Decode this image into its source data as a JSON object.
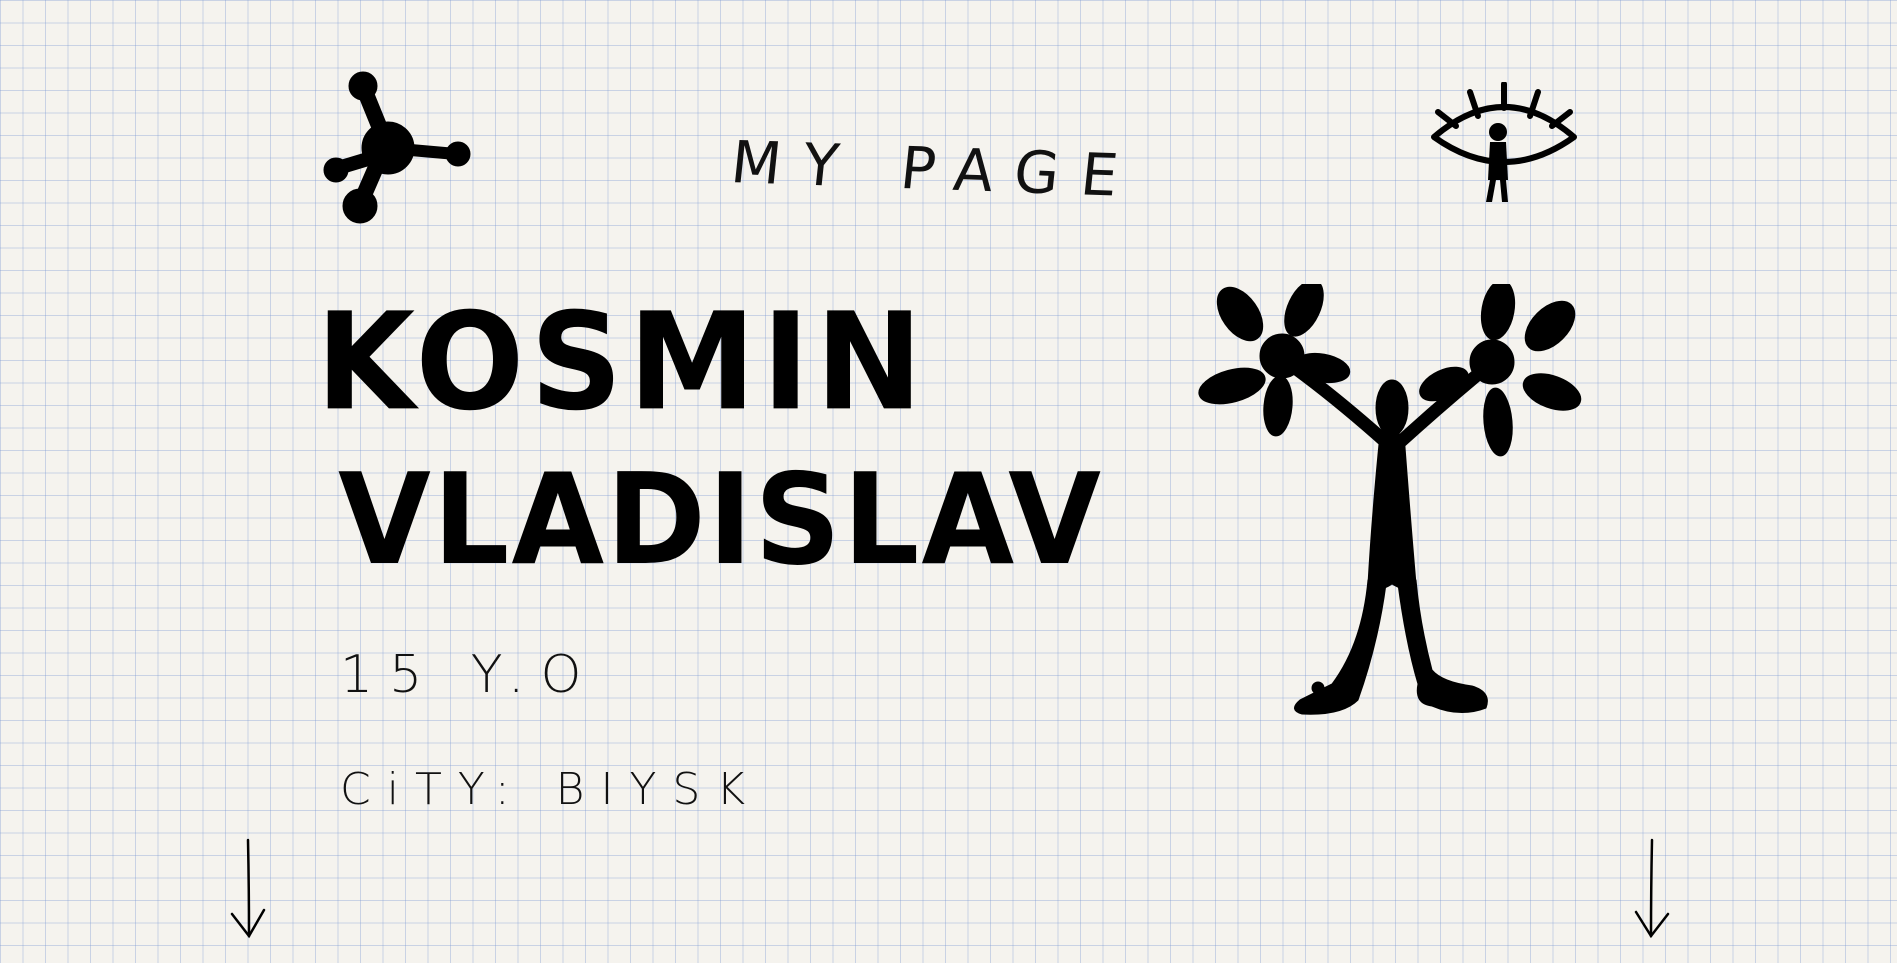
{
  "header": {
    "title": "MY PAGE"
  },
  "profile": {
    "first_line": "KOSMIN",
    "second_line": "VLADISLAV",
    "age": "15 Y.O",
    "city": "CiTY: BIYSK"
  },
  "icons": {
    "top_left": "molecule-blob-icon",
    "top_right": "eye-figure-icon",
    "figure": "flower-person-illustration",
    "arrow_left": "arrow-down-icon",
    "arrow_right": "arrow-down-icon"
  },
  "colors": {
    "ink": "#000000",
    "paper": "#f5f3ee",
    "grid": "#90a8dc"
  }
}
